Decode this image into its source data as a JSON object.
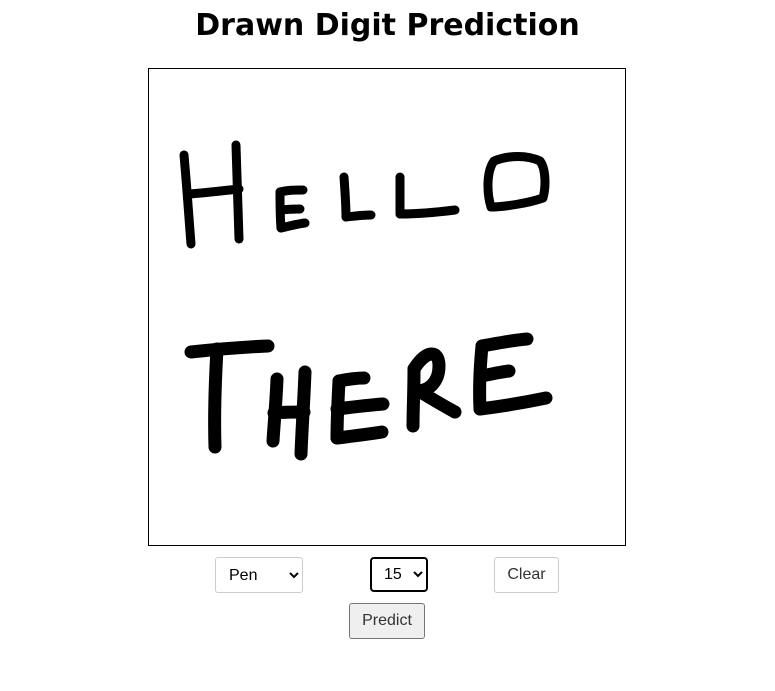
{
  "page": {
    "title": "Drawn Digit Prediction"
  },
  "canvas": {
    "ink_color": "#000000",
    "background_color": "#ffffff"
  },
  "controls": {
    "tool": {
      "selected": "Pen",
      "options": [
        "Pen"
      ]
    },
    "brush_size": {
      "selected": "15",
      "options": [
        "15"
      ]
    },
    "clear_label": "Clear",
    "predict_label": "Predict"
  }
}
